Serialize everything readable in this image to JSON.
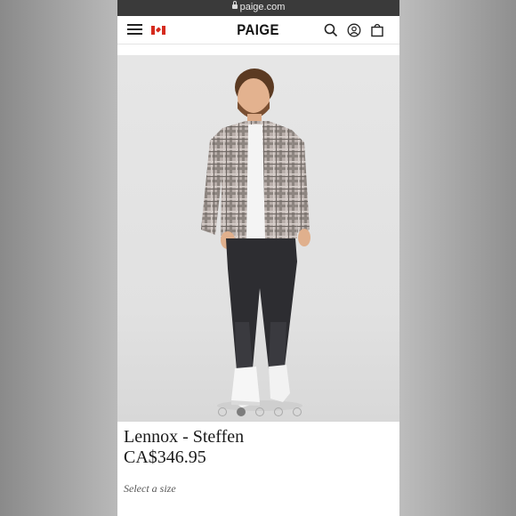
{
  "browser": {
    "url": "paige.com"
  },
  "header": {
    "brand": "PAIGE"
  },
  "product": {
    "name": "Lennox - Steffen",
    "price": "CA$346.95",
    "size_prompt": "Select a size"
  },
  "carousel": {
    "total": 5,
    "active_index": 1
  },
  "icons": [
    "lock-icon",
    "menu-icon",
    "canada-flag-icon",
    "search-icon",
    "account-icon",
    "bag-icon"
  ],
  "colors": {
    "flag_red": "#d52b1e",
    "url_bar": "#3a3a3a",
    "text": "#1a1a1a"
  }
}
